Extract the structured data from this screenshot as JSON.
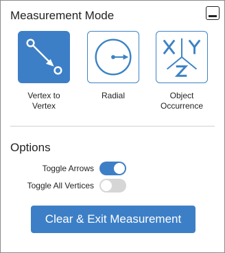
{
  "panel": {
    "title": "Measurement Mode",
    "minimize_icon": "minimize-icon"
  },
  "modes": [
    {
      "label_line1": "Vertex to",
      "label_line2": "Vertex",
      "icon": "vertex-to-vertex-icon",
      "selected": true
    },
    {
      "label_line1": "Radial",
      "label_line2": "",
      "icon": "radial-icon",
      "selected": false
    },
    {
      "label_line1": "Object",
      "label_line2": "Occurrence",
      "icon": "xyz-axes-icon",
      "selected": false
    }
  ],
  "options": {
    "title": "Options",
    "toggles": [
      {
        "label": "Toggle Arrows",
        "on": true
      },
      {
        "label": "Toggle All Vertices",
        "on": false
      }
    ]
  },
  "actions": {
    "clear_exit_label": "Clear & Exit Measurement"
  },
  "colors": {
    "accent": "#3d7fc6",
    "toggle_off": "#d6d6d6",
    "text": "#222222"
  }
}
